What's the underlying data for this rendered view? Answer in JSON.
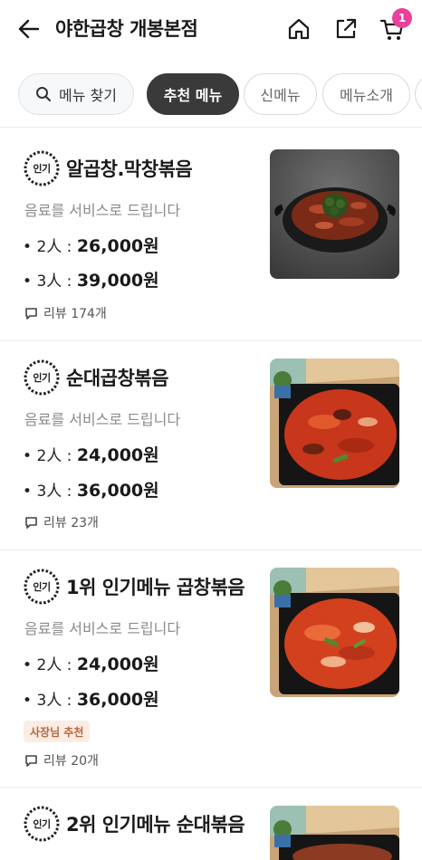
{
  "header": {
    "title": "야한곱창 개봉본점",
    "cart_count": "1"
  },
  "tabs": {
    "search_label": "메뉴 찾기",
    "items": [
      "추천 메뉴",
      "신메뉴",
      "메뉴소개"
    ]
  },
  "icons": {
    "back": "arrow-left-icon",
    "home": "home-icon",
    "share": "share-icon",
    "cart": "cart-icon",
    "search": "search-icon",
    "review": "comment-icon"
  },
  "colors": {
    "accent_badge": "#ea3f9a",
    "active_tab": "#3a3a3a",
    "owner_tag_bg": "#fbece4",
    "owner_tag_text": "#b5673a"
  },
  "menu_items": [
    {
      "badge": "인기",
      "name": "알곱창.막창볶음",
      "description": "음료를 서비스로 드립니다",
      "prices": [
        {
          "label": "2人",
          "value": "26,000원"
        },
        {
          "label": "3人",
          "value": "39,000원"
        }
      ],
      "review": "리뷰 174개"
    },
    {
      "badge": "인기",
      "name": "순대곱창볶음",
      "description": "음료를 서비스로 드립니다",
      "prices": [
        {
          "label": "2人",
          "value": "24,000원"
        },
        {
          "label": "3人",
          "value": "36,000원"
        }
      ],
      "review": "리뷰 23개"
    },
    {
      "badge": "인기",
      "name": "1위 인기메뉴 곱창볶음",
      "description": "음료를 서비스로 드립니다",
      "prices": [
        {
          "label": "2人",
          "value": "24,000원"
        },
        {
          "label": "3人",
          "value": "36,000원"
        }
      ],
      "tag": "사장님 추천",
      "review": "리뷰 20개"
    },
    {
      "badge": "인기",
      "name": "2위 인기메뉴 순대볶음"
    }
  ]
}
